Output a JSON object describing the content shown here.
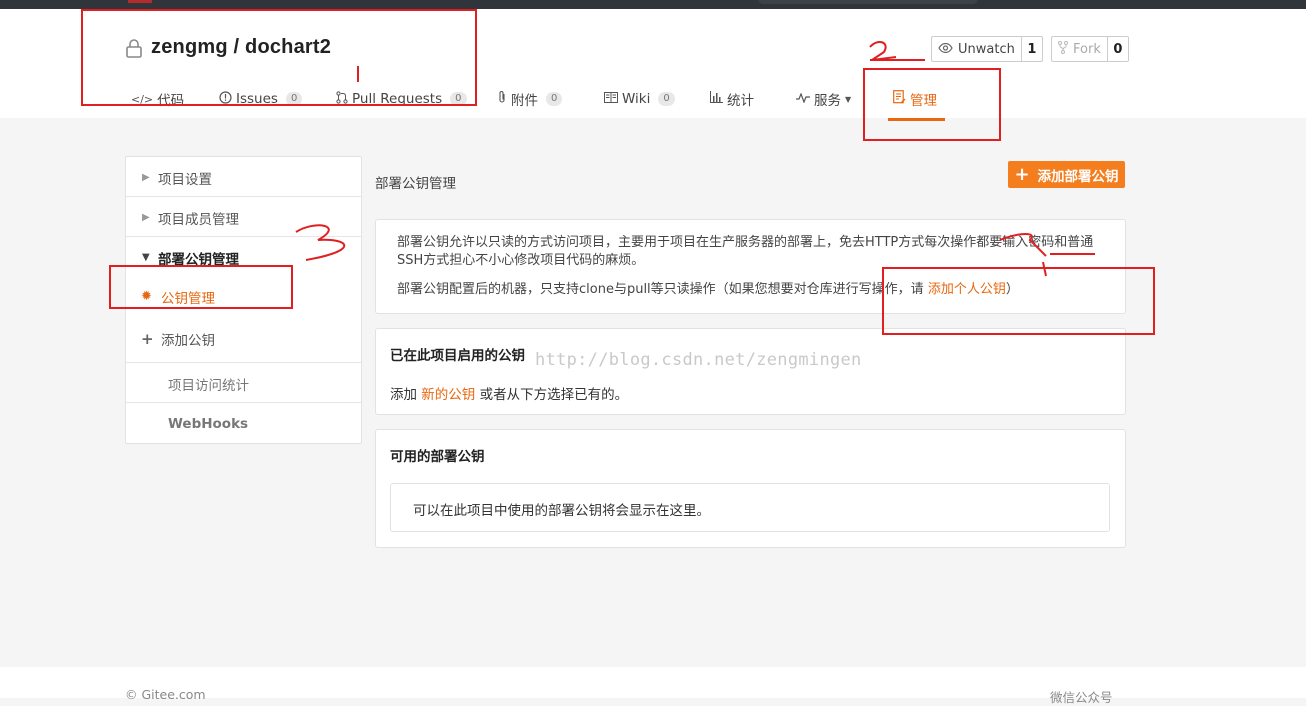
{
  "repo": {
    "title": "zengmg / dochart2"
  },
  "actions": {
    "watch_label": "Unwatch",
    "watch_count": "1",
    "fork_label": "Fork",
    "fork_count": "0"
  },
  "tabs": [
    {
      "label": "代码",
      "icon": "code-icon"
    },
    {
      "label": "Issues",
      "badge": "0",
      "icon": "issues-icon"
    },
    {
      "label": "Pull Requests",
      "badge": "0",
      "icon": "pull-request-icon"
    },
    {
      "label": "附件",
      "badge": "0",
      "icon": "paperclip-icon"
    },
    {
      "label": "Wiki",
      "badge": "0",
      "icon": "wiki-icon"
    },
    {
      "label": "统计",
      "icon": "bar-chart-icon"
    },
    {
      "label": "服务",
      "icon": "pulse-icon"
    },
    {
      "label": "管理",
      "icon": "manage-icon"
    }
  ],
  "sidebar": {
    "items": [
      {
        "label": "项目设置"
      },
      {
        "label": "项目成员管理"
      },
      {
        "label": "部署公钥管理"
      },
      {
        "label": "公钥管理"
      },
      {
        "label": "添加公钥"
      },
      {
        "label": "项目访问统计"
      },
      {
        "label": "WebHooks"
      }
    ]
  },
  "main": {
    "title": "部署公钥管理",
    "add_button": "添加部署公钥",
    "info_line1": "部署公钥允许以只读的方式访问项目，主要用于项目在生产服务器的部署上，免去HTTP方式每次操作都要输入密码和普通SSH方式担心不小心修改项目代码的麻烦。",
    "info_line2_prefix": "部署公钥配置后的机器，只支持clone与pull等只读操作（如果您想要对仓库进行写操作，请 ",
    "info_line2_link": "添加个人公钥",
    "info_line2_suffix": "）",
    "enabled": {
      "heading": "已在此项目启用的公钥",
      "text_prefix": "添加 ",
      "text_link": "新的公钥",
      "text_suffix": " 或者从下方选择已有的。"
    },
    "available": {
      "heading": "可用的部署公钥",
      "empty_text": "可以在此项目中使用的部署公钥将会显示在这里。"
    }
  },
  "watermark": "http://blog.csdn.net/zengmingen",
  "footer": {
    "copyright": "© Gitee.com",
    "wechat": "微信公众号"
  },
  "colors": {
    "accent": "#e8670f",
    "button": "#f47d1e",
    "annotation": "#e02020"
  }
}
